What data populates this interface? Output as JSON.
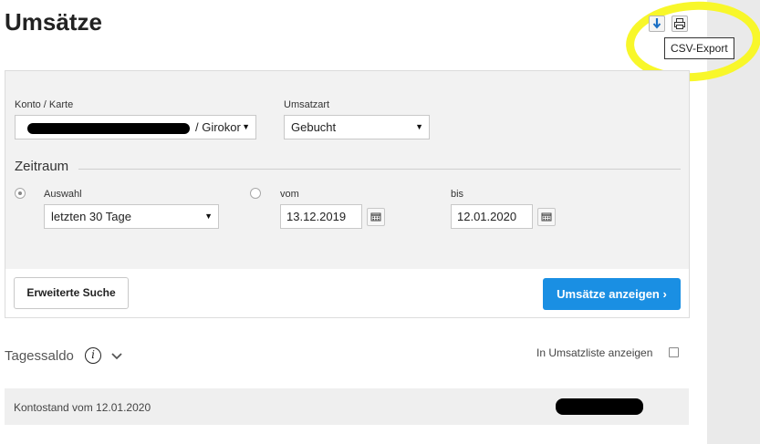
{
  "page": {
    "title": "Umsätze"
  },
  "toolbar": {
    "download_icon": "download-arrow-icon",
    "print_icon": "printer-icon",
    "tooltip": "CSV-Export",
    "highlight_color": "#f8f72a"
  },
  "form": {
    "account": {
      "label": "Konto / Karte",
      "value": "/ Girokor"
    },
    "type": {
      "label": "Umsatzart",
      "value": "Gebucht"
    },
    "period": {
      "title": "Zeitraum",
      "selection": {
        "label": "Auswahl",
        "value": "letzten 30 Tage",
        "checked": true
      },
      "range": {
        "checked": false
      },
      "from": {
        "label": "vom",
        "value": "13.12.2019"
      },
      "to": {
        "label": "bis",
        "value": "12.01.2020"
      }
    },
    "extended_search_label": "Erweiterte Suche",
    "show_button_label": "Umsätze anzeigen ›",
    "accent_color": "#1a8fe3"
  },
  "daily_balance": {
    "label": "Tagessaldo",
    "info_icon": "i",
    "show_in_list_label": "In Umsatzliste anzeigen",
    "show_in_list_checked": false
  },
  "balance": {
    "label": "Kontostand vom 12.01.2020"
  }
}
